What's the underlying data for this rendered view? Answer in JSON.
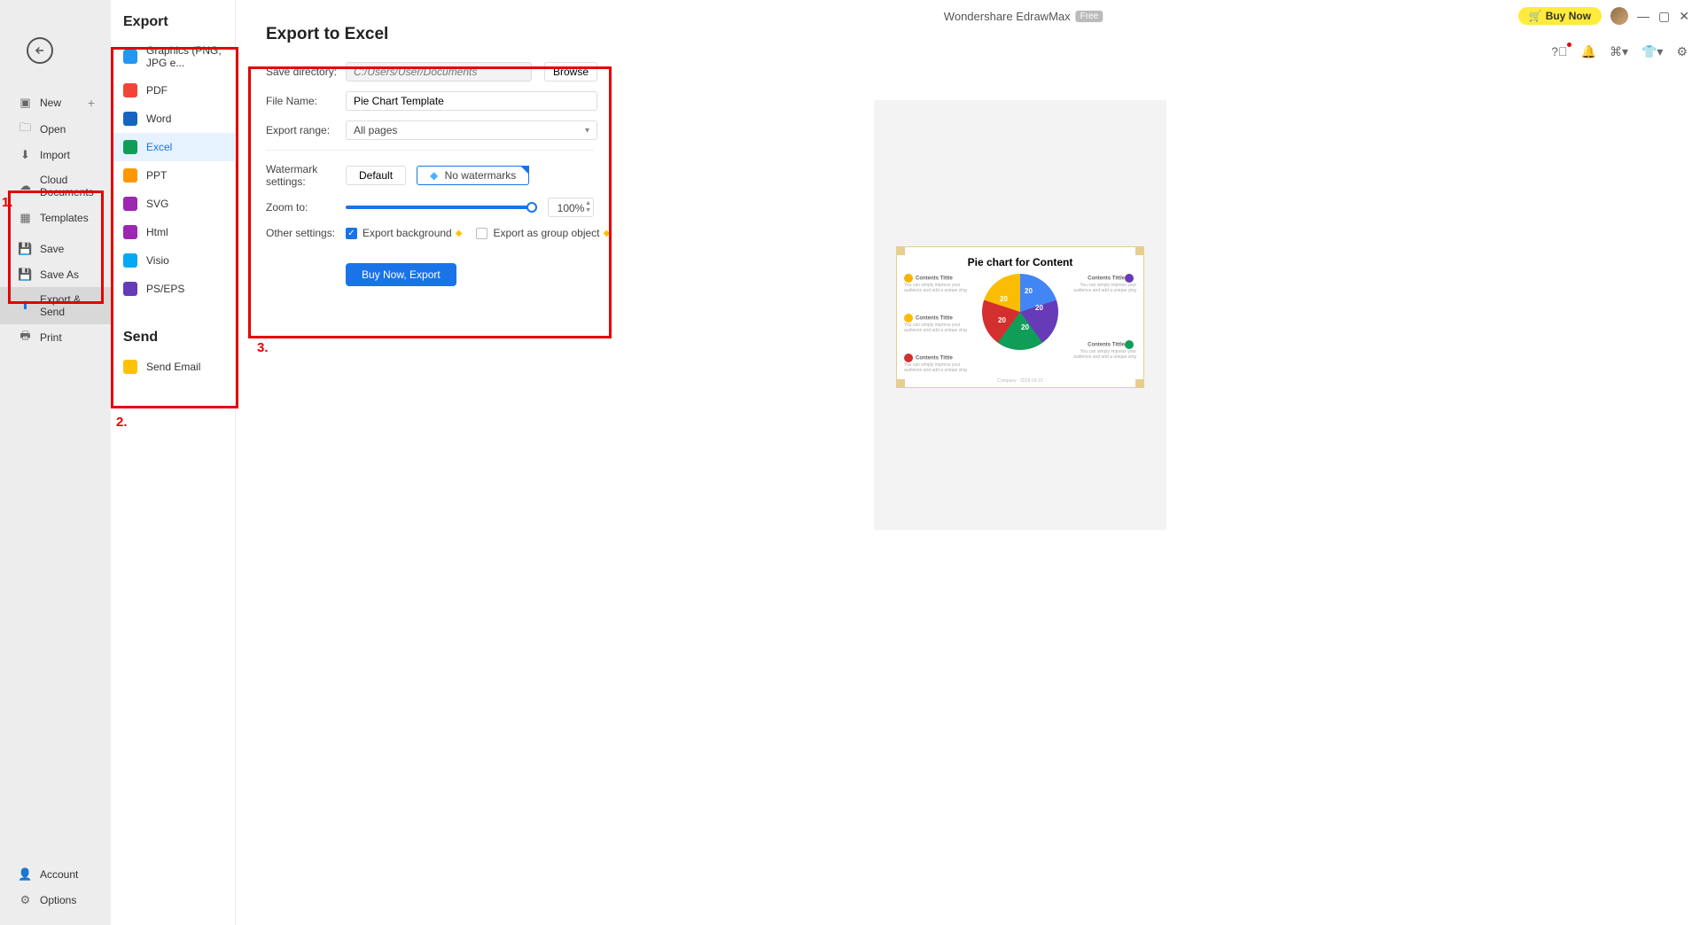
{
  "titlebar": {
    "app_name": "Wondershare EdrawMax",
    "badge": "Free",
    "buy_now": "Buy Now"
  },
  "sidebar": {
    "new": "New",
    "open": "Open",
    "import": "Import",
    "cloud": "Cloud Documents",
    "templates": "Templates",
    "save": "Save",
    "save_as": "Save As",
    "export_send": "Export & Send",
    "print": "Print",
    "account": "Account",
    "options": "Options"
  },
  "export_col": {
    "heading_export": "Export",
    "heading_send": "Send",
    "graphics": "Graphics (PNG, JPG e...",
    "pdf": "PDF",
    "word": "Word",
    "excel": "Excel",
    "ppt": "PPT",
    "svg": "SVG",
    "html": "Html",
    "visio": "Visio",
    "pseps": "PS/EPS",
    "send_email": "Send Email"
  },
  "panel": {
    "title": "Export to Excel",
    "save_dir_label": "Save directory:",
    "save_dir_placeholder": "C:/Users/User/Documents",
    "browse": "Browse",
    "file_name_label": "File Name:",
    "file_name_value": "Pie Chart Template",
    "range_label": "Export range:",
    "range_value": "All pages",
    "watermark_label": "Watermark settings:",
    "wm_default": "Default",
    "wm_none": "No watermarks",
    "zoom_label": "Zoom to:",
    "zoom_value": "100%",
    "other_label": "Other settings:",
    "export_bg": "Export background",
    "export_group": "Export as group object",
    "buy_export": "Buy Now, Export"
  },
  "preview": {
    "title": "Pie chart for Content",
    "slice_value": "20",
    "ct_title": "Contents Tittle",
    "ct_sub1": "You can simply impress your",
    "ct_sub2": "audience and add a unique zing",
    "footer": "Company · 2019-03-21"
  },
  "annotations": {
    "l1": "1.",
    "l2": "2.",
    "l3": "3."
  },
  "chart_data": {
    "type": "pie",
    "title": "Pie chart for Content",
    "categories": [
      "Contents Tittle",
      "Contents Tittle",
      "Contents Tittle",
      "Contents Tittle",
      "Contents Tittle"
    ],
    "values": [
      20,
      20,
      20,
      20,
      20
    ],
    "colors": [
      "#4285f4",
      "#673ab7",
      "#0f9d58",
      "#d32f2f",
      "#fbbc04"
    ]
  }
}
